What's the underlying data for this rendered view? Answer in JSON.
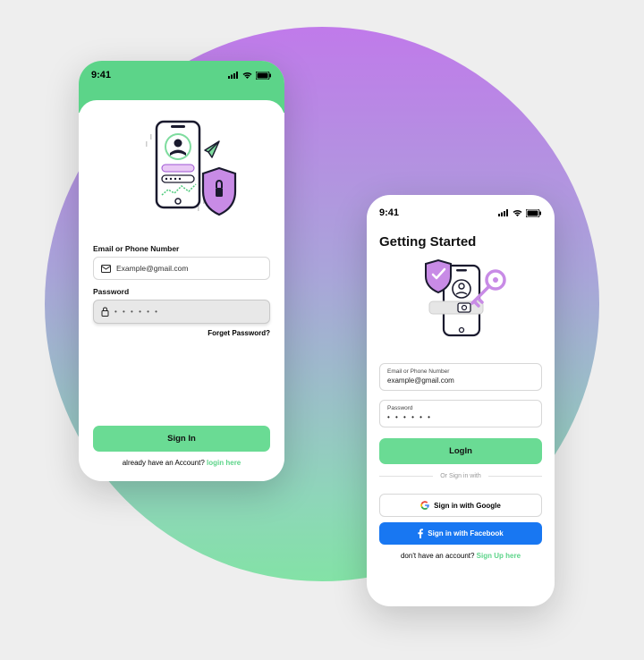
{
  "status": {
    "time": "9:41"
  },
  "screenA": {
    "email_label": "Email or Phone Number",
    "email_placeholder": "Example@gmail.com",
    "password_label": "Password",
    "password_value": "• • • • • •",
    "forgot": "Forget Password?",
    "submit": "Sign In",
    "footer_text": "already have an Account? ",
    "footer_link": "login here"
  },
  "screenB": {
    "title": "Getting Started",
    "email_label": "Email or Phone Number",
    "email_value": "example@gmail.com",
    "password_label": "Password",
    "password_value": "• • • • • •",
    "submit": "LogIn",
    "divider": "Or Sign in with",
    "google": "Sign in with Google",
    "facebook": "Sign in with Facebook",
    "footer_text": "don't have an account? ",
    "footer_link": "Sign Up here"
  }
}
